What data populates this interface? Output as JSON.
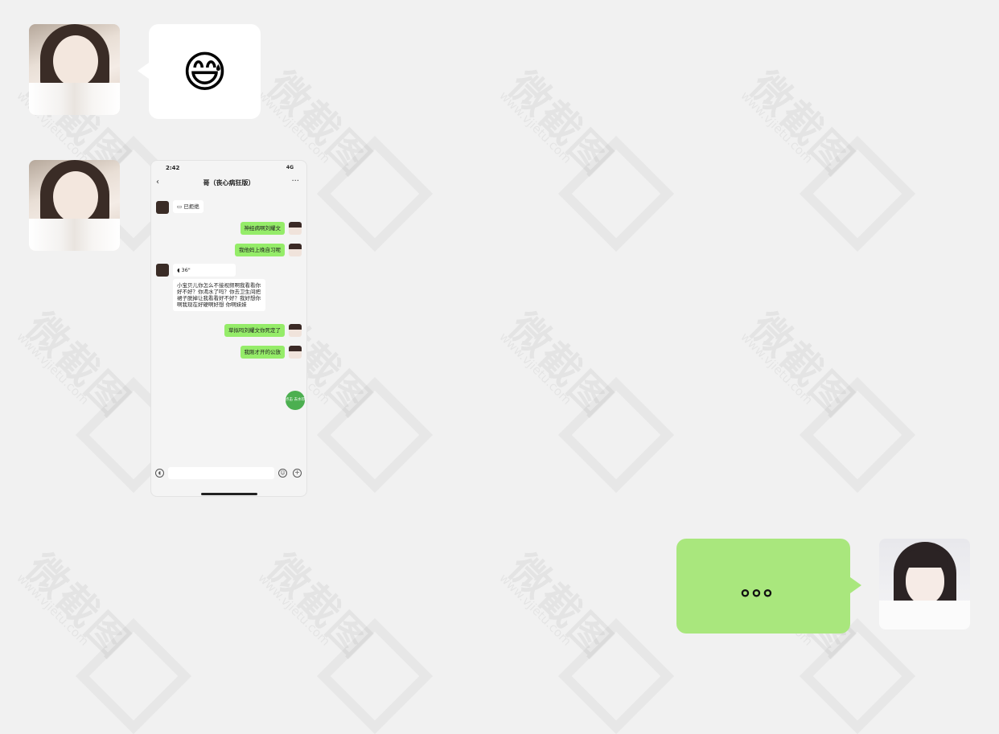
{
  "chat": {
    "message1": {
      "emoji": "😅"
    },
    "message3": {
      "text": "。。。"
    }
  },
  "screenshot": {
    "status_time": "2:42",
    "status_signal": "4G",
    "title": "哥（丧心病狂版）",
    "call_status": "已拒绝",
    "messages": [
      {
        "side": "right",
        "text": "神经病啊刘耀文"
      },
      {
        "side": "right",
        "text": "我他妈上晚自习呢"
      },
      {
        "side": "left",
        "text": "36\""
      },
      {
        "side": "left",
        "text": "小宝贝儿你怎么不接视频啊我看看你好不好？你渴水了吗？你去卫生间把裙子脱掉让我看看好不好？我好想你啊我现在好硬啊好想 你啊妹妹"
      },
      {
        "side": "right",
        "text": "草拟吗刘耀文你死定了"
      },
      {
        "side": "right",
        "text": "我刚才开的公放"
      }
    ],
    "fab_label": "点击 去水印"
  },
  "watermark": {
    "brand": "微截图",
    "url": "www.vjietu.com"
  }
}
